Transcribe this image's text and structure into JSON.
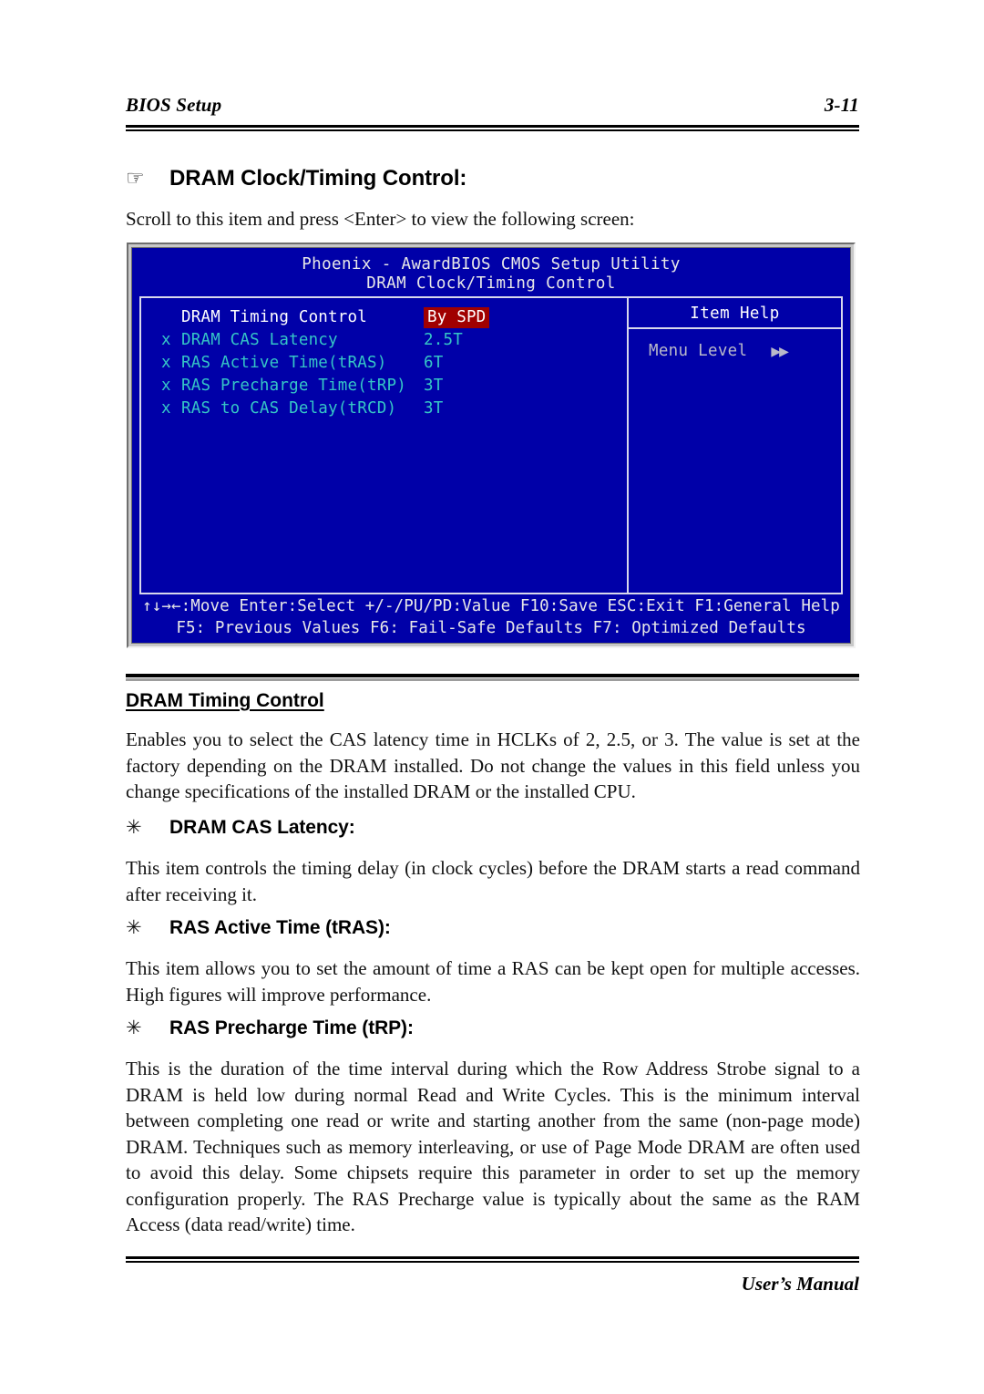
{
  "header": {
    "left_title": "BIOS Setup",
    "page_number": "3-11"
  },
  "section": {
    "hand_bullet": "☞",
    "heading": "DRAM Clock/Timing Control:",
    "intro": "Scroll to this item and press <Enter> to view the following screen:"
  },
  "bios": {
    "title": "Phoenix - AwardBIOS CMOS Setup Utility",
    "subtitle": "DRAM Clock/Timing Control",
    "rows": [
      {
        "mark": "",
        "label": "DRAM Timing Control",
        "value": "By SPD",
        "state": "active",
        "highlight": true
      },
      {
        "mark": "x",
        "label": "DRAM CAS Latency",
        "value": "2.5T",
        "state": "disabled",
        "highlight": false
      },
      {
        "mark": "x",
        "label": "RAS Active Time(tRAS)",
        "value": "6T",
        "state": "disabled",
        "highlight": false
      },
      {
        "mark": "x",
        "label": "RAS Precharge Time(tRP)",
        "value": "3T",
        "state": "disabled",
        "highlight": false
      },
      {
        "mark": "x",
        "label": "RAS to CAS Delay(tRCD)",
        "value": "3T",
        "state": "disabled",
        "highlight": false
      }
    ],
    "item_help_title": "Item Help",
    "menu_level_label": "Menu Level",
    "menu_level_arrows": "▶▶",
    "footer_line1": "↑↓→←:Move  Enter:Select  +/-/PU/PD:Value  F10:Save  ESC:Exit  F1:General Help",
    "footer_line2": "F5: Previous Values     F6: Fail-Safe Defaults     F7: Optimized Defaults",
    "colors": {
      "background": "#0000a8",
      "frame": "#d8d8ec",
      "highlight_bg": "#a00000",
      "highlight_fg": "#ffffff",
      "disabled_text": "#35c6c6",
      "active_text": "#ffffff",
      "help_text": "#b9b9c9",
      "bezel": "#c8c8c8"
    }
  },
  "body": {
    "star_bullet": "✳",
    "sub1_title": "DRAM Timing Control",
    "sub1_text": "Enables you to select the CAS latency time in HCLKs of 2, 2.5, or 3. The value is set at the factory depending on the DRAM installed. Do not change the values in this field unless you change specifications of the installed DRAM or the installed CPU.",
    "sub2_title": "DRAM CAS Latency:",
    "sub2_text": "This item controls the timing delay (in clock cycles) before the DRAM starts a read command after receiving it.",
    "sub3_title": "RAS Active Time (tRAS):",
    "sub3_text": "This item allows you to set the amount of time a RAS can be kept open for multiple accesses. High figures will improve performance.",
    "sub4_title": "RAS Precharge Time (tRP):",
    "sub4_text": "This is the duration of the time interval during which the Row Address Strobe signal to a DRAM is held low during normal Read and Write Cycles. This is the minimum interval between completing one read or write and starting another from the same (non-page mode) DRAM. Techniques such as memory interleaving, or use of Page Mode DRAM are often used to avoid this delay. Some chipsets require this parameter in order to set up the memory configuration properly. The RAS Precharge value is typically about the same as the RAM Access (data read/write) time."
  },
  "footer": {
    "right_text": "User’s Manual"
  }
}
